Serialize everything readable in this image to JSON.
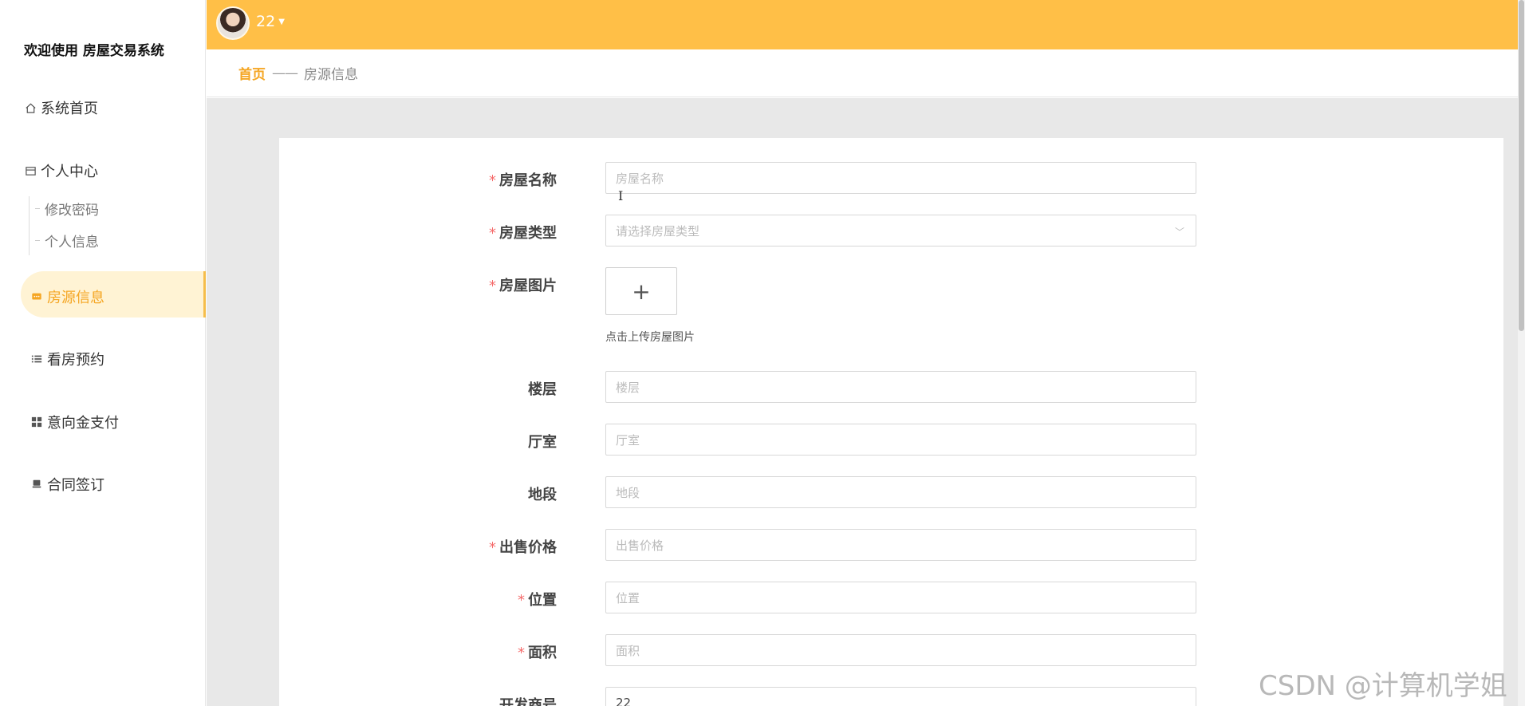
{
  "sidebar": {
    "welcome": "欢迎使用 房屋交易系统",
    "items": [
      {
        "label": "系统首页",
        "icon": "home-icon"
      },
      {
        "label": "个人中心",
        "icon": "wallet-icon",
        "children": [
          {
            "label": "修改密码"
          },
          {
            "label": "个人信息"
          }
        ]
      },
      {
        "label": "房源信息",
        "icon": "chat-icon",
        "active": true
      },
      {
        "label": "看房预约",
        "icon": "list-icon"
      },
      {
        "label": "意向金支付",
        "icon": "grid-icon"
      },
      {
        "label": "合同签订",
        "icon": "seat-icon"
      }
    ]
  },
  "header": {
    "username": "22",
    "accent_color": "#ffbf47"
  },
  "breadcrumb": {
    "home": "首页",
    "separator": "——",
    "current": "房源信息"
  },
  "form": {
    "house_name": {
      "label": "房屋名称",
      "required": true,
      "placeholder": "房屋名称",
      "value": ""
    },
    "house_type": {
      "label": "房屋类型",
      "required": true,
      "placeholder": "请选择房屋类型",
      "value": ""
    },
    "house_image": {
      "label": "房屋图片",
      "required": true,
      "hint": "点击上传房屋图片"
    },
    "floor": {
      "label": "楼层",
      "required": false,
      "placeholder": "楼层",
      "value": ""
    },
    "rooms": {
      "label": "厅室",
      "required": false,
      "placeholder": "厅室",
      "value": ""
    },
    "section": {
      "label": "地段",
      "required": false,
      "placeholder": "地段",
      "value": ""
    },
    "price": {
      "label": "出售价格",
      "required": true,
      "placeholder": "出售价格",
      "value": ""
    },
    "location": {
      "label": "位置",
      "required": true,
      "placeholder": "位置",
      "value": ""
    },
    "area": {
      "label": "面积",
      "required": true,
      "placeholder": "面积",
      "value": ""
    },
    "developer": {
      "label": "开发商号",
      "required": false,
      "placeholder": "",
      "value": "22"
    }
  },
  "required_mark": "*",
  "watermark": "CSDN @计算机学姐"
}
